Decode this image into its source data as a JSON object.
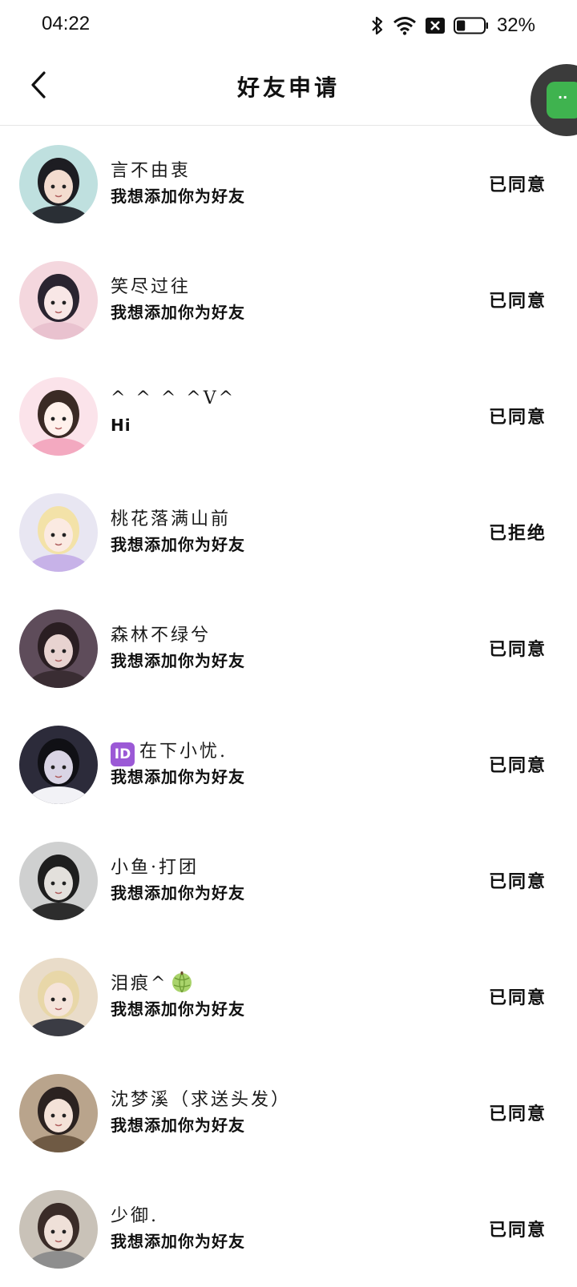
{
  "status_bar": {
    "time": "04:22",
    "battery": "32%",
    "battery_level": 0.32,
    "icons": [
      "bluetooth-icon",
      "wifi-icon",
      "sim-blocked-icon",
      "battery-icon"
    ]
  },
  "header": {
    "title": "好友申请",
    "back_icon": "chevron-left-icon"
  },
  "float_button": {
    "icon": "chat-bubble-icon",
    "label": "··",
    "accent": "#3fb34f"
  },
  "requests": [
    {
      "name": "言不由衷",
      "message": "我想添加你为好友",
      "status": "已同意",
      "avatar": "avatar-1"
    },
    {
      "name": "笑尽过往",
      "message": "我想添加你为好友",
      "status": "已同意",
      "avatar": "avatar-2"
    },
    {
      "name": "^ ^ ^ ^V^",
      "message": "Hi",
      "status": "已同意",
      "avatar": "avatar-3"
    },
    {
      "name": "桃花落满山前",
      "message": "我想添加你为好友",
      "status": "已拒绝",
      "avatar": "avatar-4"
    },
    {
      "name": "森林不绿兮",
      "message": "我想添加你为好友",
      "status": "已同意",
      "avatar": "avatar-5"
    },
    {
      "badge": "ID",
      "name": "在下小忧.",
      "message": "我想添加你为好友",
      "status": "已同意",
      "avatar": "avatar-6"
    },
    {
      "name": "小鱼·打团",
      "message": "我想添加你为好友",
      "status": "已同意",
      "avatar": "avatar-7"
    },
    {
      "name": "泪痕^",
      "message": "我想添加你为好友",
      "status": "已同意",
      "avatar": "avatar-8",
      "emoji": "melon-emoji"
    },
    {
      "name": "沈梦溪（求送头发）",
      "message": "我想添加你为好友",
      "status": "已同意",
      "avatar": "avatar-9"
    },
    {
      "name": "少御.",
      "message": "我想添加你为好友",
      "status": "已同意",
      "avatar": "avatar-10"
    }
  ]
}
